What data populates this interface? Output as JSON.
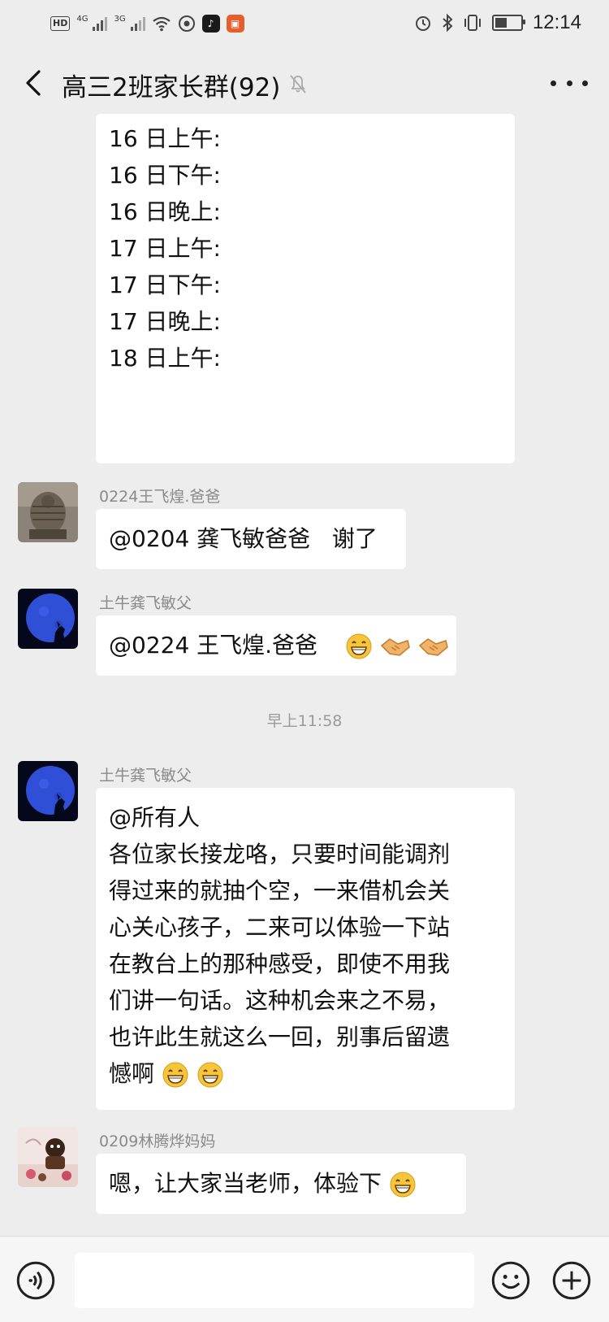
{
  "status_bar": {
    "hd_label": "HD",
    "net1": "4G",
    "net2": "3G",
    "time": "12:14",
    "icons": [
      "hd-icon",
      "signal-4g-icon",
      "signal-3g-icon",
      "wifi-icon",
      "weibo-icon",
      "tiktok-icon",
      "app-icon",
      "alarm-icon",
      "bluetooth-icon",
      "vibrate-icon",
      "battery-icon"
    ]
  },
  "header": {
    "title": "高三2班家长群(92)",
    "icons": [
      "back-chevron-icon",
      "mute-bell-icon",
      "more-dots-icon"
    ]
  },
  "messages": [
    {
      "type": "schedule",
      "lines": [
        "16 日上午:",
        "16 日下午:",
        "16 日晚上:",
        "17 日上午:",
        "17 日下午:",
        "17 日晚上:",
        "18 日上午:"
      ]
    },
    {
      "sender": "0224王飞煌.爸爸",
      "avatar": "statue-avatar",
      "text": "@0204 龚飞敏爸爸   谢了"
    },
    {
      "sender": "土牛龚飞敏父",
      "avatar": "wolf-moon-avatar",
      "text": "@0224 王飞煌.爸爸",
      "emojis": [
        "grin-emoji",
        "handshake-emoji",
        "handshake-emoji"
      ]
    },
    {
      "timestamp": "早上11:58"
    },
    {
      "sender": "土牛龚飞敏父",
      "avatar": "wolf-moon-avatar",
      "lines": [
        "@所有人",
        "各位家长接龙咯，只要时间能调剂",
        "得过来的就抽个空，一来借机会关",
        "心关心孩子，二来可以体验一下站",
        "在教台上的那种感受，即使不用我",
        "们讲一句话。这种机会来之不易，",
        "也许此生就这么一回，别事后留遗",
        "憾啊"
      ],
      "emojis": [
        "grin-emoji",
        "grin-emoji"
      ]
    },
    {
      "sender": "0209林腾烨妈妈",
      "avatar": "cake-avatar",
      "text": "嗯，让大家当老师，体验下",
      "emojis": [
        "grin-emoji"
      ]
    }
  ],
  "input_bar": {
    "placeholder": "",
    "icons": [
      "voice-icon",
      "emoji-face-icon",
      "plus-icon"
    ]
  },
  "colors": {
    "background": "#ededed",
    "bubble": "#ffffff",
    "text": "#111111",
    "sender": "#8a8a8a",
    "emoji_face": "#f6c63a",
    "handshake": "#f1b36a",
    "moon": "#2f4fd6"
  }
}
